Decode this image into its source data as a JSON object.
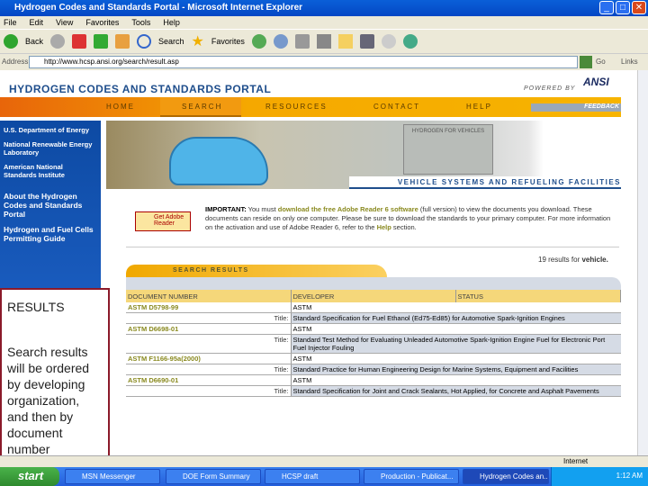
{
  "window": {
    "title": "Hydrogen Codes and Standards Portal - Microsoft Internet Explorer"
  },
  "menu": [
    "File",
    "Edit",
    "View",
    "Favorites",
    "Tools",
    "Help"
  ],
  "toolbar": {
    "back": "Back",
    "search": "Search",
    "favorites": "Favorites"
  },
  "address": {
    "label": "Address",
    "value": "http://www.hcsp.ansi.org/search/result.asp",
    "go": "Go",
    "links": "Links"
  },
  "portal": {
    "title": "HYDROGEN CODES AND STANDARDS PORTAL",
    "powered_by": "POWERED BY",
    "ansi": "ANSI",
    "nav": [
      "HOME",
      "SEARCH",
      "RESOURCES",
      "CONTACT",
      "HELP"
    ],
    "feedback": "FEEDBACK"
  },
  "sidebar": {
    "links": [
      "U.S. Department of Energy",
      "National Renewable Energy Laboratory",
      "American National Standards Institute"
    ],
    "sections": [
      "About the Hydrogen Codes and Standards Portal",
      "Hydrogen and Fuel Cells Permitting Guide"
    ]
  },
  "banner": {
    "sign": "HYDROGEN FOR VEHICLES",
    "caption": "VEHICLE SYSTEMS AND REFUELING FACILITIES"
  },
  "notice": {
    "adobe_badge": "Get Adobe Reader",
    "important": "IMPORTANT:",
    "pre": "You must",
    "link": "download the free Adobe Reader 6 software",
    "post": "(full version) to view the documents you download. These documents can reside on only one computer. Please be sure to download the standards to your primary computer. For more information on the activation and use of Adobe Reader 6, refer to the",
    "help": "Help",
    "end": "section."
  },
  "results": {
    "count_text": "19 results for",
    "keyword": "vehicle.",
    "tab": "SEARCH RESULTS",
    "headers": [
      "DOCUMENT NUMBER",
      "DEVELOPER",
      "STATUS"
    ],
    "title_label": "Title:",
    "rows": [
      {
        "doc": "ASTM D5798-99",
        "dev": "ASTM",
        "title": "Standard Specification for Fuel Ethanol (Ed75-Ed85) for Automotive Spark-Ignition Engines"
      },
      {
        "doc": "ASTM D6698-01",
        "dev": "ASTM",
        "title": "Standard Test Method for Evaluating Unleaded Automotive Spark-Ignition Engine Fuel for Electronic Port Fuel Injector Fouling"
      },
      {
        "doc": "ASTM F1166-95a(2000)",
        "dev": "ASTM",
        "title": "Standard Practice for Human Engineering Design for Marine Systems, Equipment and Facilities"
      },
      {
        "doc": "ASTM D6690-01",
        "dev": "ASTM",
        "title": "Standard Specification for Joint and Crack Sealants, Hot Applied, for Concrete and Asphalt Pavements"
      }
    ]
  },
  "overlay": {
    "heading": "RESULTS",
    "body": "Search results will be ordered by developing organization, and then by document number"
  },
  "status": {
    "zone": "Internet"
  },
  "taskbar": {
    "start": "start",
    "tasks": [
      "MSN Messenger",
      "DOE Form Summary",
      "HCSP draft",
      "Production - Publicat...",
      "Hydrogen Codes an..."
    ],
    "clock": "1:12 AM"
  }
}
